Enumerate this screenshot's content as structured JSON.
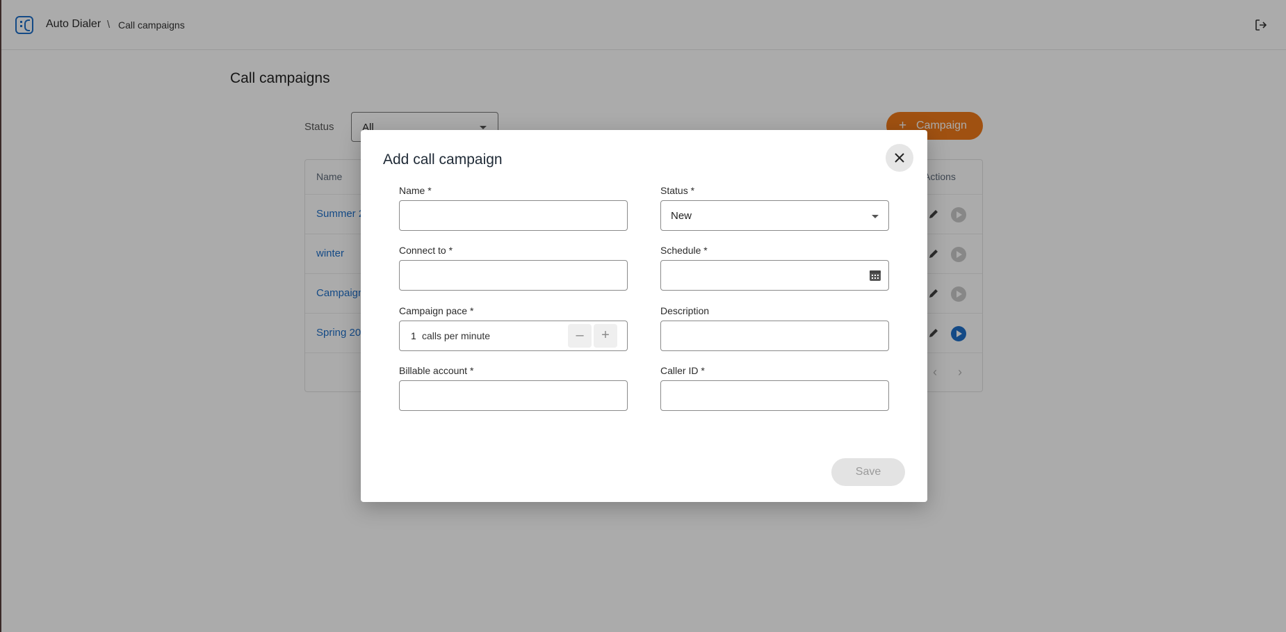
{
  "header": {
    "app_name": "Auto Dialer",
    "breadcrumb_separator": "\\",
    "breadcrumb_current": "Call campaigns"
  },
  "page": {
    "title": "Call campaigns",
    "status_filter_label": "Status",
    "status_filter_value": "All",
    "add_campaign_label": "Campaign",
    "table": {
      "columns": [
        "Name",
        "Actions"
      ],
      "rows": [
        {
          "name": "Summer 2",
          "play_active": false
        },
        {
          "name": "winter",
          "play_active": false
        },
        {
          "name": "Campaign",
          "play_active": false
        },
        {
          "name": "Spring 20",
          "play_active": true
        }
      ]
    }
  },
  "modal": {
    "title": "Add call campaign",
    "fields": {
      "name_label": "Name *",
      "name_value": "",
      "status_label": "Status *",
      "status_value": "New",
      "connect_to_label": "Connect to *",
      "connect_to_value": "",
      "schedule_label": "Schedule *",
      "schedule_value": "",
      "pace_label": "Campaign pace *",
      "pace_value": "1",
      "pace_unit": "calls per minute",
      "description_label": "Description",
      "description_value": "",
      "billable_label": "Billable account *",
      "billable_value": "",
      "caller_id_label": "Caller ID *",
      "caller_id_value": ""
    },
    "save_label": "Save"
  },
  "colors": {
    "accent_blue": "#1e6fc8",
    "accent_orange": "#ef7a1a",
    "overlay": "rgba(0,0,0,0.33)"
  },
  "icons": [
    "app-logo-icon",
    "logout-icon",
    "plus-icon",
    "edit-icon",
    "play-icon",
    "close-icon",
    "calendar-icon",
    "minus-icon",
    "chevron-left-icon",
    "chevron-right-icon"
  ]
}
